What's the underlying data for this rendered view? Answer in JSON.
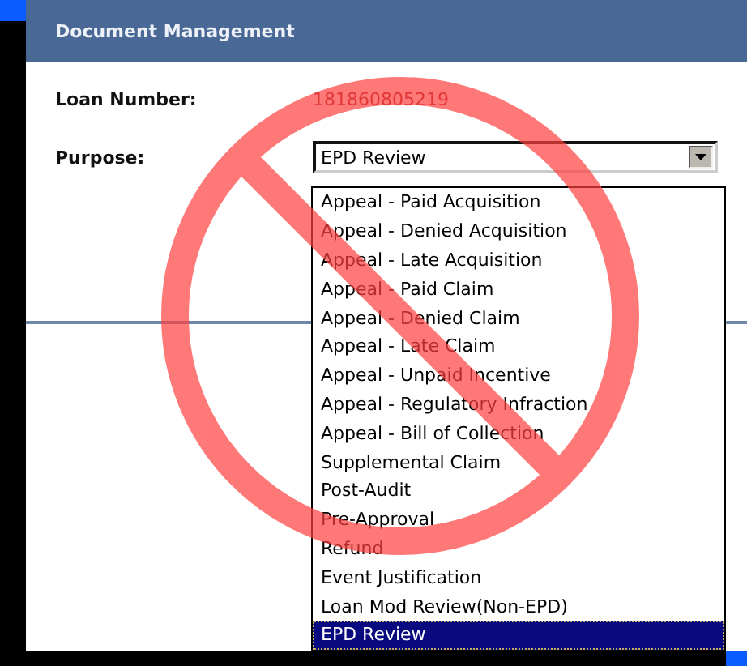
{
  "panel": {
    "title": "Document Management"
  },
  "fields": {
    "loan_number": {
      "label": "Loan Number:",
      "value": "181860805219"
    },
    "purpose": {
      "label": "Purpose:",
      "value": "EPD Review",
      "expanded": true
    }
  },
  "options": [
    {
      "label": "Appeal - Paid Acquisition",
      "selected": false
    },
    {
      "label": "Appeal - Denied Acquisition",
      "selected": false
    },
    {
      "label": "Appeal - Late Acquisition",
      "selected": false
    },
    {
      "label": "Appeal - Paid Claim",
      "selected": false
    },
    {
      "label": "Appeal - Denied Claim",
      "selected": false
    },
    {
      "label": "Appeal - Late Claim",
      "selected": false
    },
    {
      "label": "Appeal - Unpaid Incentive",
      "selected": false
    },
    {
      "label": "Appeal - Regulatory Infraction",
      "selected": false
    },
    {
      "label": "Appeal - Bill of Collection",
      "selected": false
    },
    {
      "label": "Supplemental Claim",
      "selected": false
    },
    {
      "label": "Post-Audit",
      "selected": false
    },
    {
      "label": "Pre-Approval",
      "selected": false
    },
    {
      "label": "Refund",
      "selected": false
    },
    {
      "label": "Event Justification",
      "selected": false
    },
    {
      "label": "Loan Mod Review(Non-EPD)",
      "selected": false
    },
    {
      "label": "EPD Review",
      "selected": true
    }
  ]
}
